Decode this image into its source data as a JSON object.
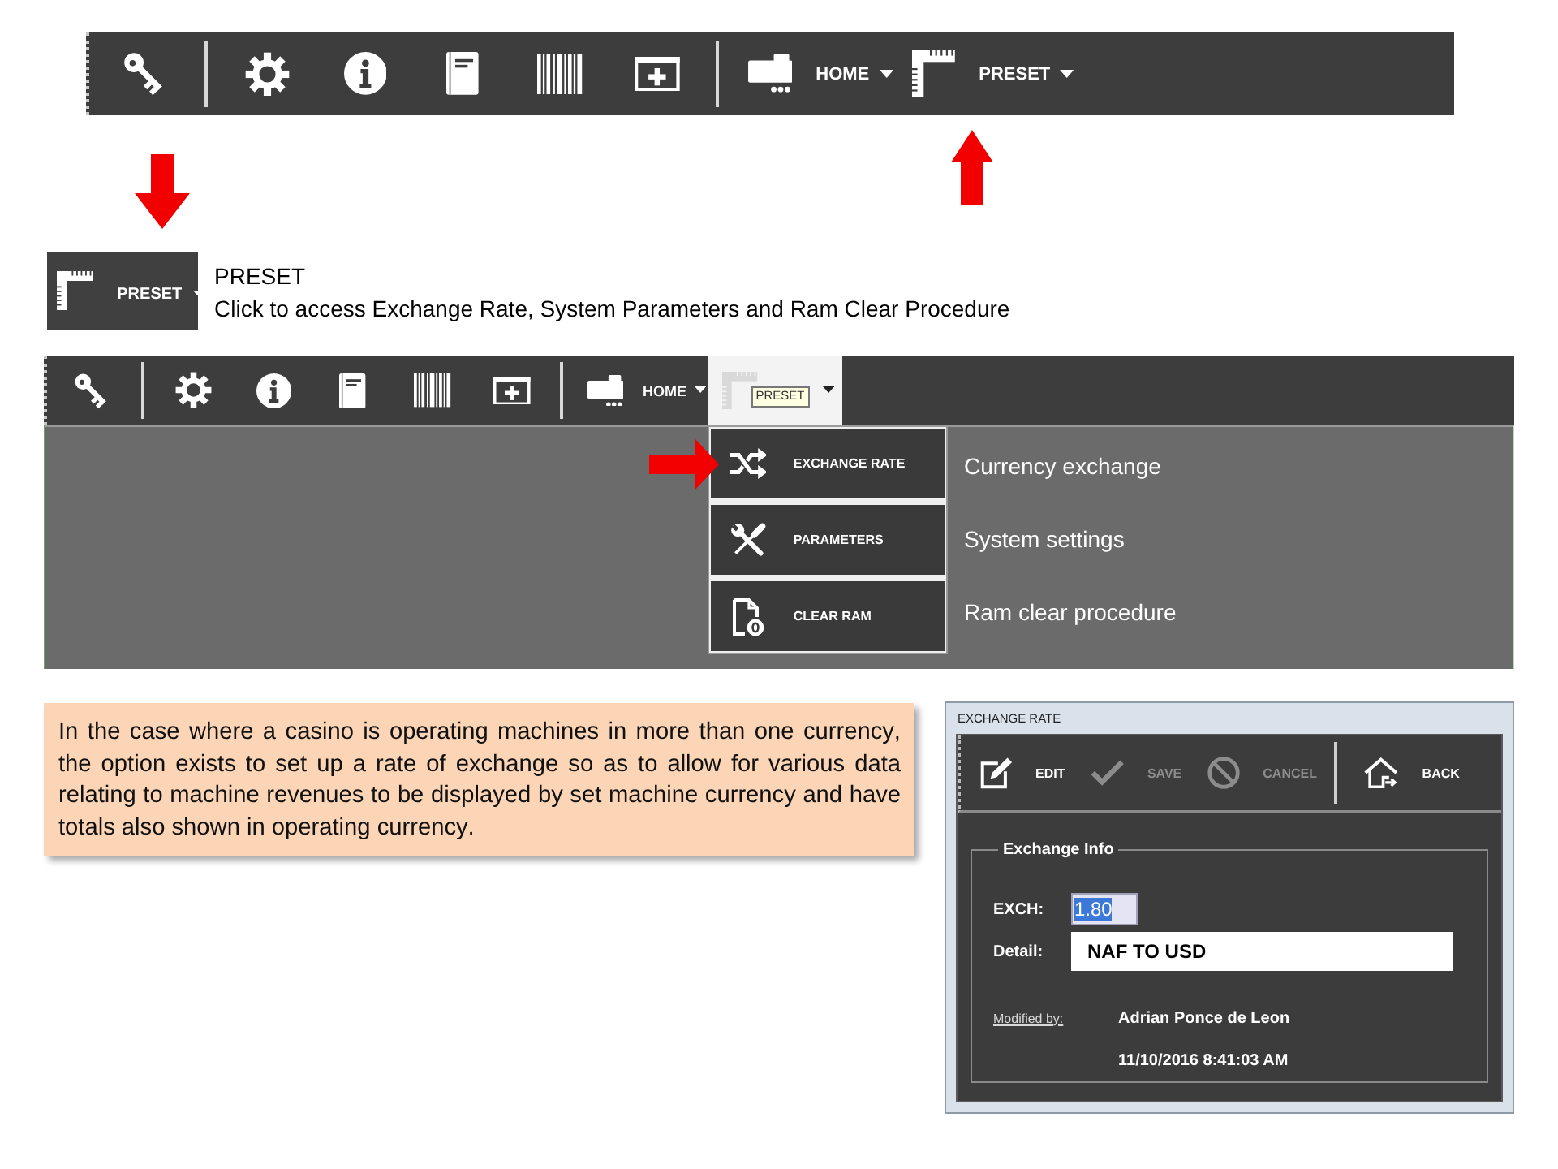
{
  "top_toolbar": {
    "menus": [
      {
        "kind": "home",
        "label": "HOME",
        "expanded": false
      },
      {
        "kind": "preset",
        "label": "PRESET",
        "expanded": false
      }
    ]
  },
  "preset_callout": {
    "button_label": "PRESET",
    "title": "PRESET",
    "description": "Click to access Exchange Rate, System Parameters and Ram Clear Procedure"
  },
  "app_window": {
    "toolbar": {
      "menus": [
        {
          "kind": "home",
          "label": "HOME",
          "expanded": false
        },
        {
          "kind": "preset",
          "tooltip": "PRESET",
          "expanded": true
        }
      ]
    },
    "dropdown": [
      {
        "kind": "exchange",
        "label": "EXCHANGE RATE",
        "pointer": true
      },
      {
        "kind": "parameters",
        "label": "PARAMETERS",
        "pointer": false
      },
      {
        "kind": "clear",
        "label": "CLEAR RAM",
        "pointer": false
      }
    ],
    "notes": [
      "Currency exchange",
      "System settings",
      "Ram clear procedure"
    ]
  },
  "note": "In the case where a casino is operating machines in more than one currency, the option exists to set up a rate of exchange so as to allow for various data relating to machine revenues to be displayed by set machine currency and have totals also shown in operating currency.",
  "exchange_dialog": {
    "title": "EXCHANGE RATE",
    "actions": [
      {
        "kind": "edit",
        "label": "EDIT",
        "disabled": false
      },
      {
        "kind": "save",
        "label": "SAVE",
        "disabled": true
      },
      {
        "kind": "cancel",
        "label": "CANCEL",
        "disabled": true
      },
      {
        "kind": "back",
        "label": "BACK",
        "disabled": false
      }
    ],
    "group_title": "Exchange Info",
    "fields": [
      {
        "kind": "number",
        "label": "EXCH:",
        "value": "1.80",
        "text_selected": true
      },
      {
        "kind": "text",
        "label": "Detail:",
        "value": "NAF TO USD",
        "text_selected": false
      }
    ],
    "modified_label": "Modified by:",
    "modified_by": "Adrian Ponce de Leon",
    "modified_at": "11/10/2016 8:41:03 AM"
  }
}
